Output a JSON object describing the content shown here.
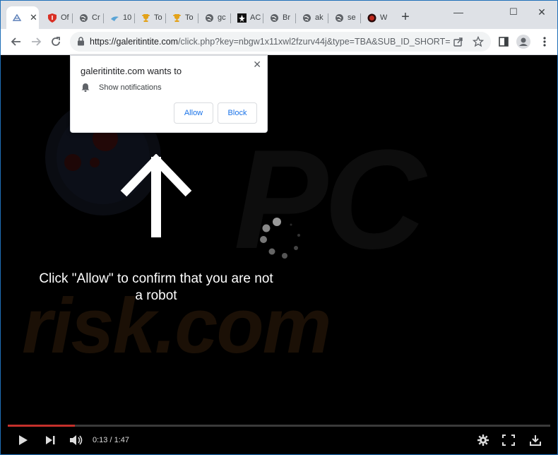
{
  "tabs": [
    {
      "label": "",
      "icon": "globe-icon",
      "active": true
    },
    {
      "label": "Of",
      "icon": "shield-icon"
    },
    {
      "label": "Cr",
      "icon": "globe-icon"
    },
    {
      "label": "10",
      "icon": "bird-icon"
    },
    {
      "label": "To",
      "icon": "trophy-icon"
    },
    {
      "label": "To",
      "icon": "trophy-icon"
    },
    {
      "label": "gc",
      "icon": "globe-icon"
    },
    {
      "label": "AC",
      "icon": "star-icon"
    },
    {
      "label": "Br",
      "icon": "globe-icon"
    },
    {
      "label": "ak",
      "icon": "globe-icon"
    },
    {
      "label": "se",
      "icon": "globe-icon"
    },
    {
      "label": "W",
      "icon": "circle-icon"
    }
  ],
  "address": {
    "host": "https://galeritintite.com",
    "path": "/click.php?key=nbgw1x11xwl2fzurv44j&type=TBA&SUB_ID_SHORT=..."
  },
  "popup": {
    "title": "galeritintite.com wants to",
    "permission": "Show notifications",
    "allow": "Allow",
    "block": "Block"
  },
  "page": {
    "message": "Click \"Allow\" to confirm that you are not a robot",
    "watermark": "risk.com",
    "watermark2": "PC"
  },
  "player": {
    "time": "0:13 / 1:47",
    "progress": 0.124
  },
  "colors": {
    "progress": "#c4302b",
    "accent": "#1a73e8"
  }
}
